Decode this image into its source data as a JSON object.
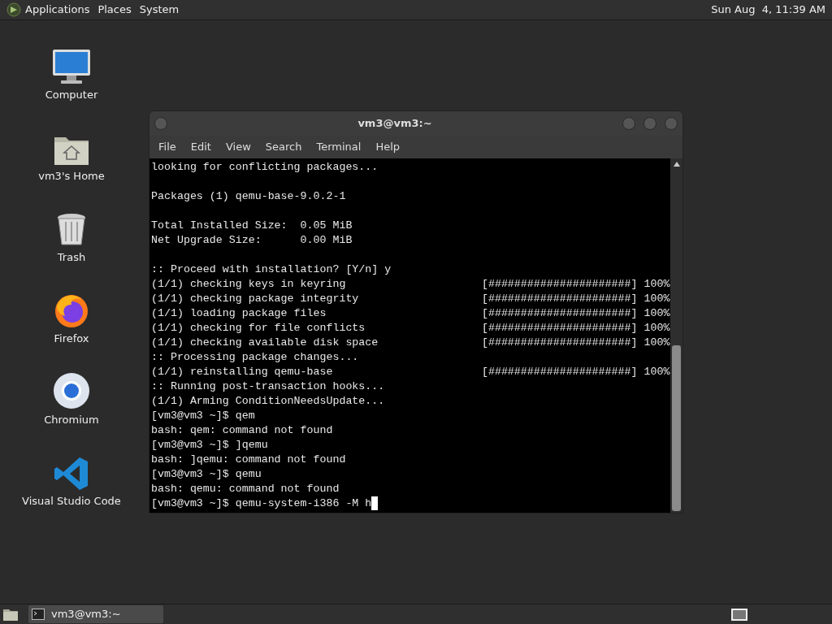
{
  "top_panel": {
    "menus": [
      "Applications",
      "Places",
      "System"
    ],
    "clock": "Sun Aug  4, 11:39 AM"
  },
  "desktop_icons": [
    {
      "label": "Computer",
      "kind": "computer"
    },
    {
      "label": "vm3's Home",
      "kind": "home"
    },
    {
      "label": "Trash",
      "kind": "trash"
    },
    {
      "label": "Firefox",
      "kind": "firefox"
    },
    {
      "label": "Chromium",
      "kind": "chromium"
    },
    {
      "label": "Visual Studio Code",
      "kind": "vscode"
    }
  ],
  "window": {
    "title": "vm3@vm3:~",
    "menu": [
      "File",
      "Edit",
      "View",
      "Search",
      "Terminal",
      "Help"
    ],
    "terminal_lines": [
      "looking for conflicting packages...",
      {
        "kind": "blank"
      },
      "Packages (1) qemu-base-9.0.2-1",
      {
        "kind": "blank"
      },
      "Total Installed Size:  0.05 MiB",
      "Net Upgrade Size:      0.00 MiB",
      {
        "kind": "blank"
      },
      ":: Proceed with installation? [Y/n] y",
      "(1/1) checking keys in keyring                     [######################] 100%",
      "(1/1) checking package integrity                   [######################] 100%",
      "(1/1) loading package files                        [######################] 100%",
      "(1/1) checking for file conflicts                  [######################] 100%",
      "(1/1) checking available disk space                [######################] 100%",
      ":: Processing package changes...",
      "(1/1) reinstalling qemu-base                       [######################] 100%",
      ":: Running post-transaction hooks...",
      "(1/1) Arming ConditionNeedsUpdate...",
      "[vm3@vm3 ~]$ qem",
      "bash: qem: command not found",
      "[vm3@vm3 ~]$ ]qemu",
      "bash: ]qemu: command not found",
      "[vm3@vm3 ~]$ qemu",
      "bash: qemu: command not found",
      "[vm3@vm3 ~]$ qemu-system-i386 -M h"
    ]
  },
  "taskbar": {
    "tasks": [
      {
        "label": "vm3@vm3:~",
        "selected": true
      }
    ]
  }
}
